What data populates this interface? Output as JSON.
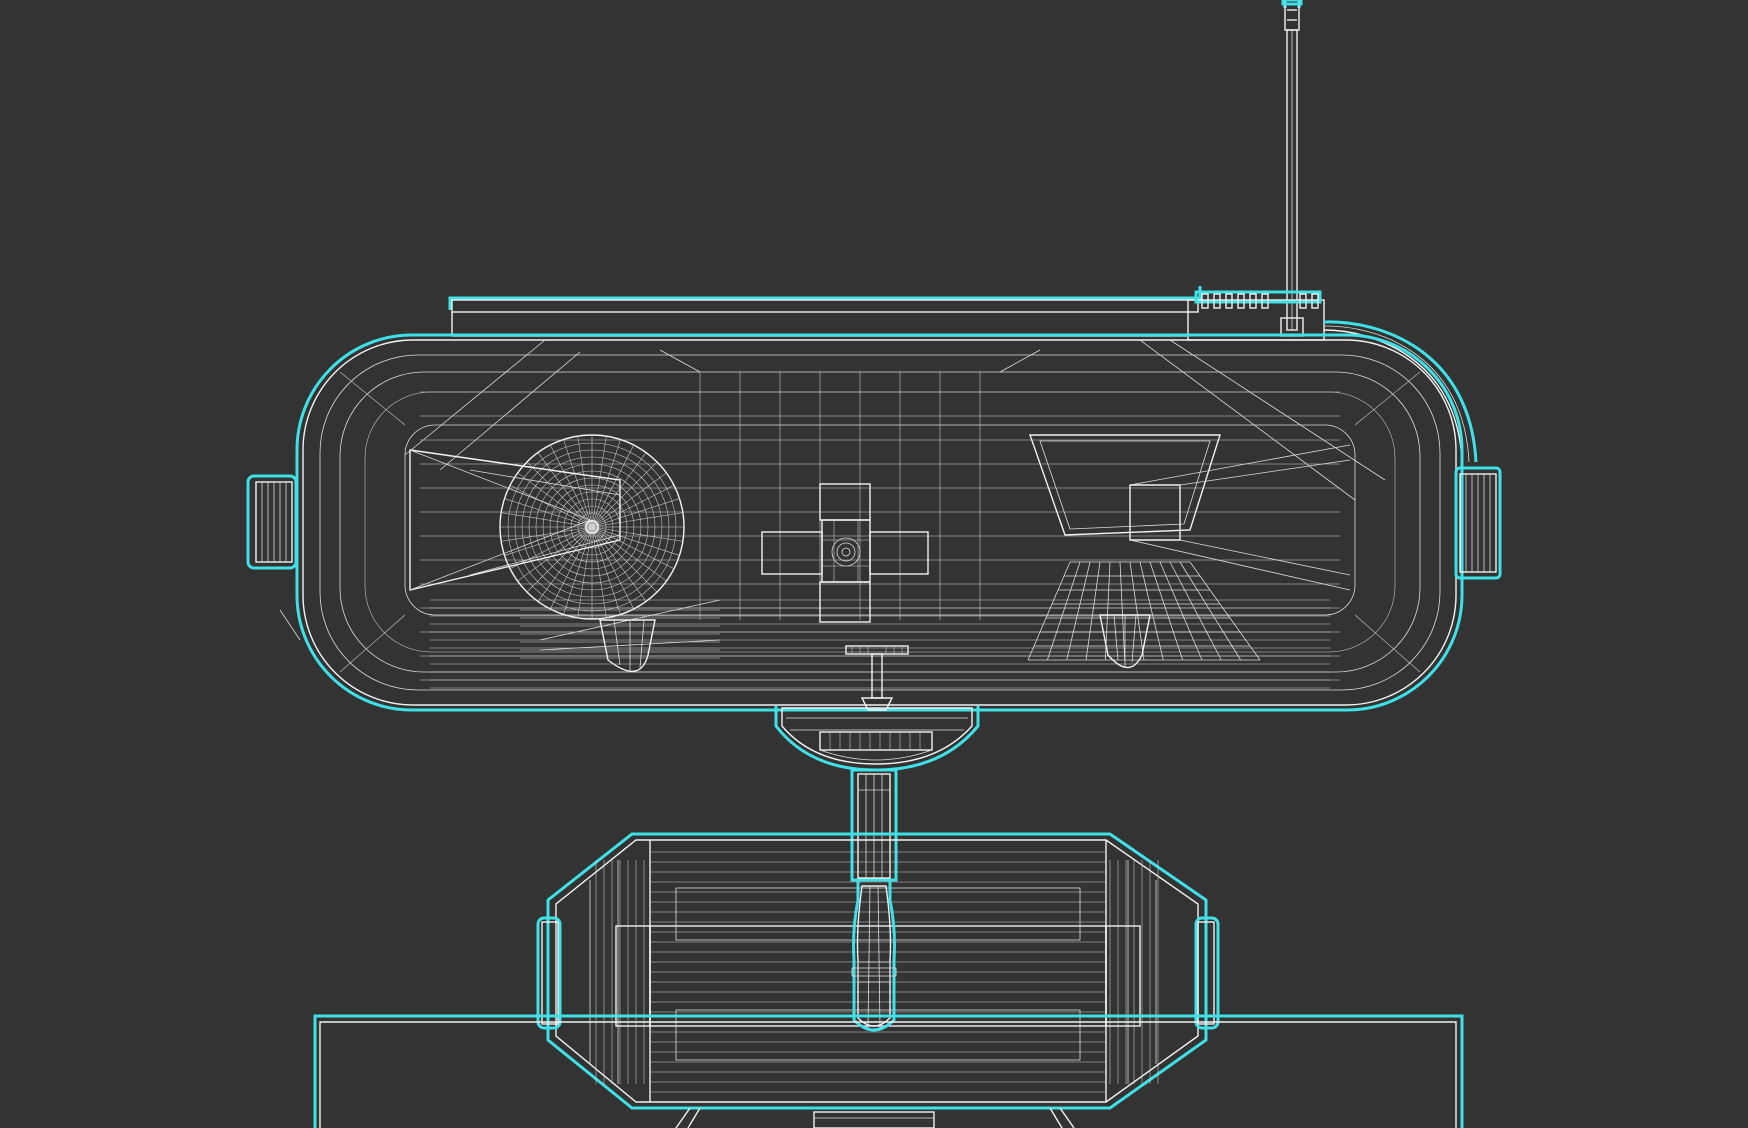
{
  "viewport": {
    "background": "#333333",
    "wire_color": "#f2f2f2",
    "selection_color": "#3fe0e6"
  },
  "model": {
    "parts": [
      {
        "name": "antenna",
        "shape": "vertical mast"
      },
      {
        "name": "head",
        "shape": "rounded capsule"
      },
      {
        "name": "left-eye",
        "shape": "round lens"
      },
      {
        "name": "right-eye",
        "shape": "trapezoid screen with grid"
      },
      {
        "name": "center-face-panel",
        "shape": "cross panel"
      },
      {
        "name": "neck",
        "shape": "pillar on dome mount"
      },
      {
        "name": "body",
        "shape": "octagonal drum"
      },
      {
        "name": "base-plate",
        "shape": "wide slab"
      }
    ]
  }
}
